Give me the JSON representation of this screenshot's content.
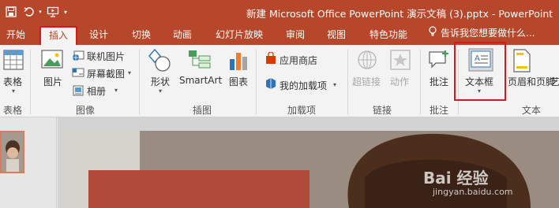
{
  "window": {
    "title": "新建 Microsoft Office PowerPoint 演示文稿 (3).pptx - PowerPoint"
  },
  "quick_access": {
    "icons": [
      "save-icon",
      "undo-icon",
      "slideshow-from-start-icon",
      "customize-qat-icon"
    ]
  },
  "tabs": [
    {
      "label": "开始"
    },
    {
      "label": "插入",
      "active": true
    },
    {
      "label": "设计"
    },
    {
      "label": "切换"
    },
    {
      "label": "动画"
    },
    {
      "label": "幻灯片放映"
    },
    {
      "label": "审阅"
    },
    {
      "label": "视图"
    },
    {
      "label": "特色功能"
    }
  ],
  "tell_me": {
    "text": "告诉我您想要做什么..."
  },
  "ribbon": {
    "groups": {
      "tables": "表格",
      "images": "图像",
      "illustrations": "插图",
      "addins": "加载项",
      "links": "链接",
      "comments": "批注",
      "text": "文本"
    },
    "buttons": {
      "table": "表格",
      "picture": "图片",
      "online_pictures": "联机图片",
      "screenshot": "屏幕截图",
      "album": "相册",
      "shapes": "形状",
      "smartart": "SmartArt",
      "chart": "图表",
      "store": "应用商店",
      "my_addins": "我的加载项",
      "hyperlink": "超链接",
      "action": "动作",
      "comment": "批注",
      "textbox": "文本框",
      "header_footer": "页眉和页脚",
      "wordart": "艺"
    },
    "disabled": [
      "hyperlink",
      "action"
    ],
    "highlighted": [
      "tab-insert",
      "textbox"
    ]
  },
  "watermark": {
    "text": "Bai 经验",
    "sub": "jingyan.baidu.com"
  },
  "colors": {
    "accent": "#b7472a",
    "ribbon_bg": "#f3f3f3",
    "highlight_box": "#d21a1a",
    "slide_shape": "#b04a3b"
  }
}
